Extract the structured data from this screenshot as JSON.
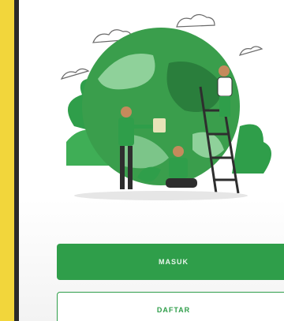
{
  "screen": {
    "illustration_icon": "earth-volunteers-illustration"
  },
  "actions": {
    "login_label": "MASUK",
    "register_label": "DAFTAR"
  },
  "colors": {
    "primary": "#2f9e4a",
    "frame": "#f2d63b"
  }
}
